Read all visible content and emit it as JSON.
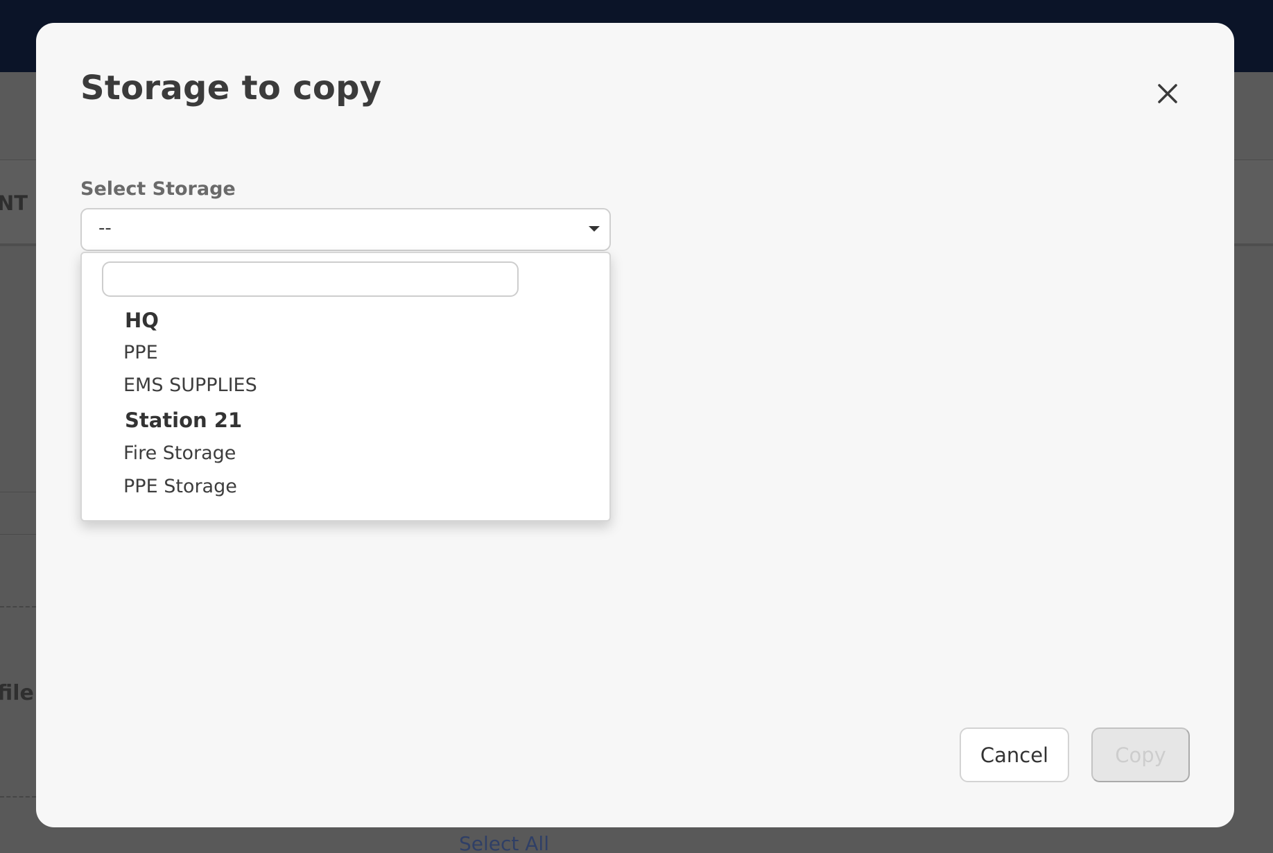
{
  "background": {
    "tab_fragment": "NT",
    "file_fragment": "file c",
    "select_all": "Select All"
  },
  "modal": {
    "title": "Storage to copy",
    "close_icon": "close-icon",
    "field_label": "Select Storage",
    "select_value": "--",
    "dropdown": {
      "search_value": "",
      "groups": [
        {
          "label": "HQ",
          "items": [
            "PPE",
            "EMS SUPPLIES"
          ]
        },
        {
          "label": "Station 21",
          "items": [
            "Fire Storage",
            "PPE Storage"
          ]
        }
      ]
    },
    "buttons": {
      "cancel": "Cancel",
      "copy": "Copy"
    }
  },
  "colors": {
    "topbar": "#0b1428",
    "overlay": "#595959",
    "modal_bg": "#f7f7f7",
    "title_text": "#3b3b3b",
    "copy_disabled_bg": "#e6e6e6",
    "copy_disabled_text": "#cdcdcd"
  }
}
